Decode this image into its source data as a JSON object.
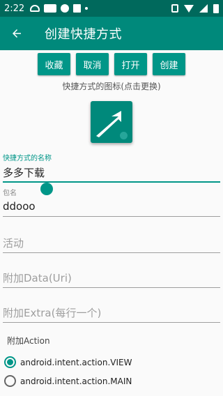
{
  "status_bar": {
    "time": "2:22"
  },
  "app_bar": {
    "title": "创建快捷方式",
    "back_icon": "arrow-back-icon"
  },
  "buttons": {
    "collect": "收藏",
    "cancel": "取消",
    "open": "打开",
    "create": "创建"
  },
  "icon_hint": "快捷方式的图标(点击更换)",
  "fields": {
    "name": {
      "label": "快捷方式的名称",
      "value": "多多下载"
    },
    "package": {
      "label": "包名",
      "value": "ddooo"
    },
    "activity": {
      "placeholder": "活动"
    },
    "data": {
      "placeholder": "附加Data(Uri)"
    },
    "extra": {
      "placeholder": "附加Extra(每行一个)"
    }
  },
  "action_section": {
    "label": "附加Action",
    "options": [
      {
        "label": "android.intent.action.VIEW",
        "checked": true
      },
      {
        "label": "android.intent.action.MAIN",
        "checked": false
      }
    ]
  },
  "colors": {
    "status_bar": "#00695c",
    "app_bar": "#00897b",
    "accent": "#009688"
  }
}
